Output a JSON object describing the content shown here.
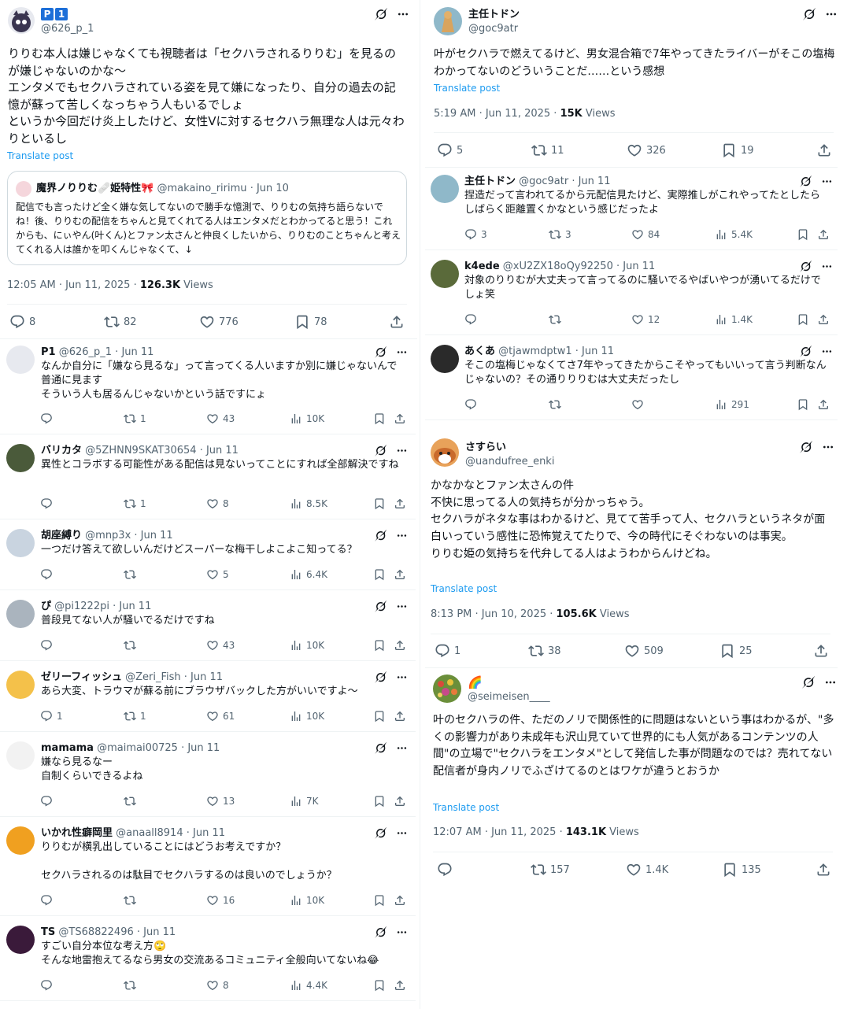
{
  "left": {
    "main": {
      "badge1": "P",
      "badge2": "1",
      "handle": "@626_p_1",
      "text": "りりむ本人は嫌じゃなくても視聴者は「セクハラされるりりむ」を見るのが嫌じゃないのかな〜\nエンタメでもセクハラされている姿を見て嫌になったり、自分の過去の記憶が蘇って苦しくなっちゃう人もいるでしょ\nというか今回だけ炎上したけど、女性Vに対するセクハラ無理な人は元々わりといるし",
      "translate": "Translate post",
      "quote": {
        "name": "魔界ノりりむ🩹姫特性🎀",
        "handle": "@makaino_ririmu",
        "date": "· Jun 10",
        "text": "配信でも言ったけど全く嫌な気してないので勝手な憶測で、りりむの気持ち語らないでね！後、りりむの配信をちゃんと見てくれてる人はエンタメだとわかってると思う！これからも、にぃやん(叶くん)とファン太さんと仲良くしたいから、りりむのことちゃんと考えてくれる人は誰かを叩くんじゃなくて、↓"
      },
      "time": "12:05 AM · Jun 11, 2025 · ",
      "views_count": "126.3K",
      "views_label": " Views",
      "replies": "8",
      "reposts": "82",
      "likes": "776",
      "bookmarks": "78"
    },
    "replies": [
      {
        "name": "P1",
        "handle": "@626_p_1 · Jun 11",
        "text": "なんか自分に「嫌なら見るな」って言ってくる人いますか別に嫌じゃないんで普通に見ます\nそういう人も居るんじゃないかという話ですにょ",
        "replies": "",
        "reposts": "1",
        "likes": "43",
        "views": "10K"
      },
      {
        "name": "バリカタ",
        "handle": "@5ZHNN9SKAT30654 · Jun 11",
        "text": "異性とコラボする可能性がある配信は見ないってことにすれば全部解決ですね",
        "replies": "",
        "reposts": "1",
        "likes": "8",
        "views": "8.5K"
      },
      {
        "name": "胡座縛り",
        "handle": "@mnp3x · Jun 11",
        "text": "一つだけ答えて欲しいんだけどスーパーな梅干しよこよこ知ってる？",
        "replies": "",
        "reposts": "",
        "likes": "5",
        "views": "6.4K"
      },
      {
        "name": "ぴ",
        "handle": "@pi1222pi · Jun 11",
        "text": "普段見てない人が騒いでるだけですね",
        "replies": "",
        "reposts": "",
        "likes": "43",
        "views": "10K"
      },
      {
        "name": "ゼリーフィッシュ",
        "handle": "@Zeri_Fish · Jun 11",
        "text": "あら大変、トラウマが蘇る前にブラウザバックした方がいいですよ〜",
        "replies": "1",
        "reposts": "1",
        "likes": "61",
        "views": "10K"
      },
      {
        "name": "mamama",
        "handle": "@maimai00725 · Jun 11",
        "text": "嫌なら見るなー\n自制くらいできるよね",
        "replies": "",
        "reposts": "",
        "likes": "13",
        "views": "7K"
      },
      {
        "name": "いかれ性癖岡里",
        "handle": "@anaall8914 · Jun 11",
        "text": "りりむが横乳出していることにはどうお考えですか？\n\nセクハラされるのは駄目でセクハラするのは良いのでしょうか？",
        "replies": "",
        "reposts": "",
        "likes": "16",
        "views": "10K"
      },
      {
        "name": "TS",
        "handle": "@TS68822496 · Jun 11",
        "text": "すごい自分本位な考え方🙄\nそんな地雷抱えてるなら男女の交流あるコミュニティ全般向いてないね😂",
        "replies": "",
        "reposts": "",
        "likes": "8",
        "views": "4.4K"
      }
    ]
  },
  "right": {
    "main1": {
      "name": "主任トドン",
      "handle": "@goc9atr",
      "text": "叶がセクハラで燃えてるけど、男女混合箱で7年やってきたライバーがそこの塩梅わかってないのどういうことだ……という感想",
      "translate": "Translate post",
      "time": "5:19 AM · Jun 11, 2025 · ",
      "views_count": "15K",
      "views_label": " Views",
      "replies": "5",
      "reposts": "11",
      "likes": "326",
      "bookmarks": "19"
    },
    "replies": [
      {
        "name": "主任トドン",
        "handle": "@goc9atr · Jun 11",
        "text": "捏造だって言われてるから元配信見たけど、実際推しがこれやってたとしたらしばらく距離置くかなという感じだったよ",
        "replies": "3",
        "reposts": "3",
        "likes": "84",
        "views": "5.4K"
      },
      {
        "name": "k4ede",
        "handle": "@xU2ZX18oQy92250 · Jun 11",
        "text": "対象のりりむが大丈夫って言ってるのに騒いでるやばいやつが湧いてるだけでしょ笑",
        "replies": "",
        "reposts": "",
        "likes": "12",
        "views": "1.4K"
      },
      {
        "name": "あくあ",
        "handle": "@tjawmdptw1 · Jun 11",
        "text": "そこの塩梅じゃなくてさ7年やってきたからこそやってもいいって言う判断なんじゃないの？その通りりりむは大丈夫だったし",
        "replies": "",
        "reposts": "",
        "likes": "",
        "views": "291"
      }
    ],
    "main2": {
      "name": "さすらい",
      "handle": "@uandufree_enki",
      "text": "かなかなとファン太さんの件\n不快に思ってる人の気持ちが分かっちゃう。\nセクハラがネタな事はわかるけど、見てて苦手って人、セクハラというネタが面白いっていう感性に恐怖覚えてたりで、今の時代にそぐわないのは事実。\nりりむ姫の気持ちを代弁してる人はようわからんけどね。",
      "translate": "Translate post",
      "time": "8:13 PM · Jun 10, 2025 · ",
      "views_count": "105.6K",
      "views_label": " Views",
      "replies": "1",
      "reposts": "38",
      "likes": "509",
      "bookmarks": "25"
    },
    "main3": {
      "name": "🌈",
      "handle": "@seimeisen____",
      "text": "叶のセクハラの件、ただのノリで関係性的に問題はないという事はわかるが、\"多くの影響力があり未成年も沢山見ていて世界的にも人気があるコンテンツの人間\"の立場で\"セクハラをエンタメ\"として発信した事が問題なのでは？売れてない配信者が身内ノリでふざけてるのとはワケが違うとおうか",
      "translate": "Translate post",
      "time": "12:07 AM · Jun 11, 2025 · ",
      "views_count": "143.1K",
      "views_label": " Views",
      "replies": "",
      "reposts": "157",
      "likes": "1.4K",
      "bookmarks": "135"
    }
  }
}
